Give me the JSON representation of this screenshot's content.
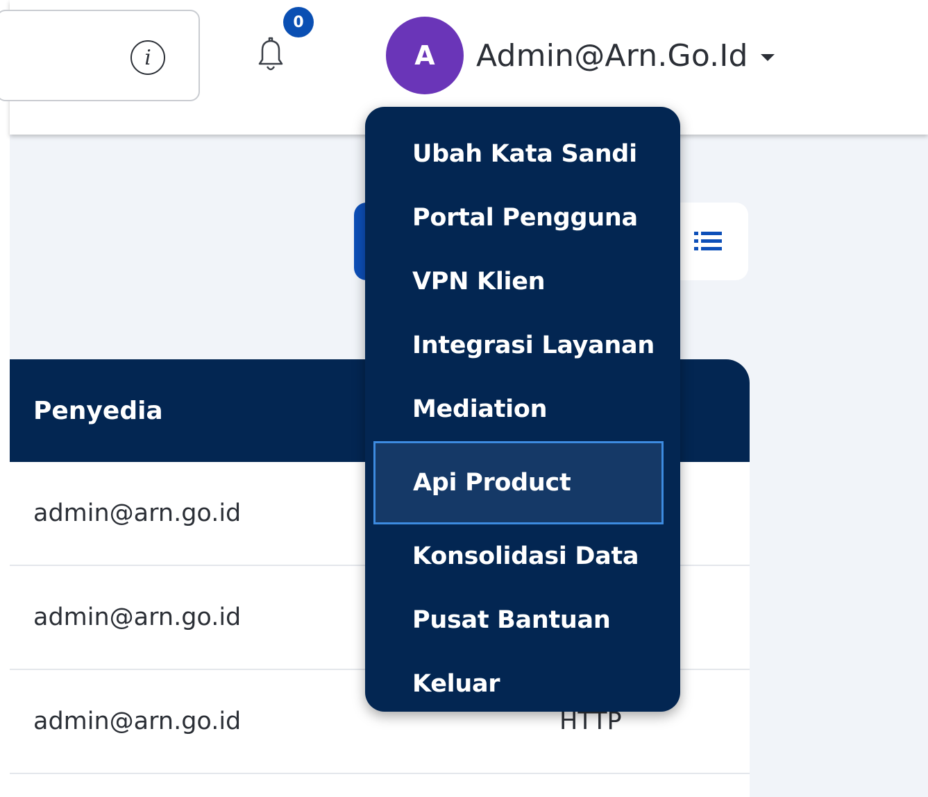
{
  "header": {
    "info_icon": "info-icon",
    "notification_icon": "bell-icon",
    "notification_count": "0",
    "user": {
      "avatar_initial": "A",
      "name": "Admin@Arn.Go.Id",
      "caret_icon": "caret-down-icon"
    }
  },
  "toolbar": {
    "view_toggle_icon": "list-icon"
  },
  "table": {
    "columns": [
      "Penyedia"
    ],
    "rows": [
      {
        "penyedia": "admin@arn.go.id",
        "protocol": ""
      },
      {
        "penyedia": "admin@arn.go.id",
        "protocol": ""
      },
      {
        "penyedia": "admin@arn.go.id",
        "protocol": "HTTP"
      }
    ]
  },
  "user_dropdown": {
    "items": [
      {
        "label": "Ubah Kata Sandi"
      },
      {
        "label": "Portal Pengguna"
      },
      {
        "label": "VPN Klien"
      },
      {
        "label": "Integrasi Layanan"
      },
      {
        "label": "Mediation"
      },
      {
        "label": "Api Product",
        "active": true
      },
      {
        "label": "Konsolidasi Data"
      },
      {
        "label": "Pusat Bantuan"
      },
      {
        "label": "Keluar"
      }
    ]
  },
  "colors": {
    "navy": "#032652",
    "primary_blue": "#0d4fb8",
    "avatar_purple": "#6a35b8",
    "badge_blue": "#0a4fb3",
    "active_border": "#3d8be0",
    "page_background": "#f1f4f9"
  }
}
